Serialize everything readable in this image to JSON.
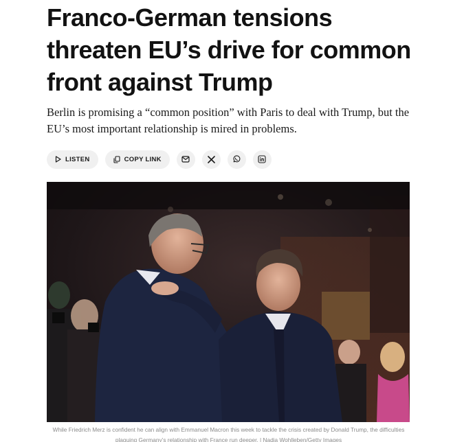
{
  "article": {
    "headline": "Franco-German tensions threaten EU’s drive for common front against Trump",
    "standfirst": "Berlin is promising a “common position” with Paris to deal with Trump, but the EU’s most important relationship is mired in problems."
  },
  "actions": {
    "listen_label": "LISTEN",
    "copy_link_label": "COPY LINK",
    "share_icons": [
      "email-icon",
      "x-icon",
      "whatsapp-icon",
      "linkedin-icon"
    ]
  },
  "photo": {
    "caption": "While Friedrich Merz is confident he can align with Emmanuel Macron this week to tackle the crisis created by Donald Trump, the difficulties plaguing Germany’s relationship with France run deeper. | Nadja Wohlleben/Getty Images"
  },
  "colors": {
    "text": "#121212",
    "pill_background": "#f0f0f0",
    "caption": "#8a8a8a"
  }
}
